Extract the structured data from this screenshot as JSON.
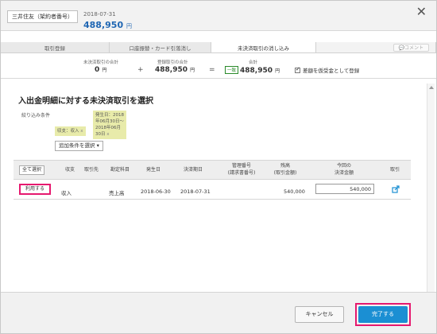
{
  "header": {
    "account_name": "三井住友（架約者番号）",
    "date": "2018-07-31",
    "amount": "488,950",
    "amount_unit": "円",
    "close_icon": "close-icon"
  },
  "tabs": [
    {
      "label": "取引登録"
    },
    {
      "label": "口座振替・カード引落消し"
    },
    {
      "label": "未決済取引の消し込み"
    },
    {
      "label": "コメント"
    }
  ],
  "summary": {
    "unsettled_label": "未決済取引の合計",
    "unsettled_value": "0",
    "plus_op": "+",
    "registered_label": "登録取引の合計",
    "registered_value": "488,950",
    "equals_op": "=",
    "total_label": "合計",
    "match_badge": "一致",
    "total_value": "488,950",
    "unit": "円",
    "checkbox_label": "差額を仮受金として登録"
  },
  "filters": {
    "section_title": "入出金明細に対する未決済取引を選択",
    "condition_label": "絞り込み条件",
    "date_tag_text": "発生日：2018年06月30日～2018年06月30日",
    "date_tag_x": "x",
    "type_tag_text": "収支：収入",
    "type_tag_x": "x",
    "add_condition_label": "追加条件を選択 ▾"
  },
  "table": {
    "select_all_label": "全て選択",
    "headers": {
      "type": "収支",
      "partner": "取引先",
      "account": "勘定科目",
      "occurrence": "発生日",
      "settlement": "決済期日",
      "mgmt1": "管理番号",
      "mgmt2": "(請求書番号)",
      "balance1": "残高",
      "balance2": "(取引金額)",
      "current1": "今回の",
      "current2": "決済金額",
      "deal": "取引"
    },
    "rows": [
      {
        "use_label": "利用する",
        "type": "収入",
        "partner": "",
        "account": "売上高",
        "occurrence": "2018-06-30",
        "settlement": "2018-07-31",
        "mgmt": "",
        "balance": "540,000",
        "current_amount": "540,000",
        "link_icon": "external-link-icon"
      }
    ]
  },
  "footer": {
    "cancel_label": "キャンセル",
    "done_label": "完了する"
  },
  "colors": {
    "accent_blue": "#1b8fd3",
    "amount_blue": "#1f66b3",
    "highlight_pink": "#e6196f",
    "filter_tag_bg": "#e8ebaa",
    "match_green": "#2a8a2a"
  }
}
